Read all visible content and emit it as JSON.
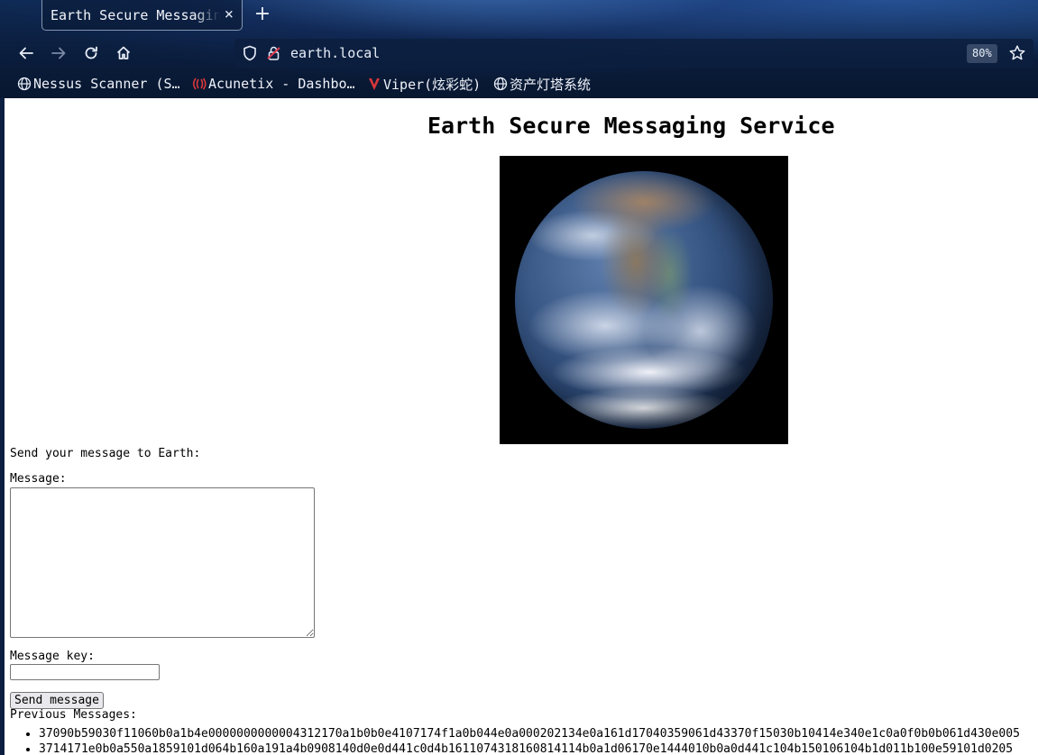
{
  "browser": {
    "tab_title": "Earth Secure Messaging Service",
    "url": "earth.local",
    "zoom": "80%",
    "bookmarks": [
      {
        "label": "Nessus Scanner (S…",
        "icon": "globe-icon"
      },
      {
        "label": "Acunetix - Dashbo…",
        "icon": "acunetix-logo-icon"
      },
      {
        "label": "Viper(炫彩蛇)",
        "icon": "viper-logo-icon"
      },
      {
        "label": "资产灯塔系统",
        "icon": "globe-icon"
      }
    ]
  },
  "page": {
    "title": "Earth Secure Messaging Service",
    "send_heading": "Send your message to Earth:",
    "message_label": "Message:",
    "message_value": "",
    "key_label": "Message key:",
    "key_value": "",
    "send_button": "Send message",
    "previous_label": "Previous Messages:",
    "messages": [
      "37090b59030f11060b0a1b4e0000000000004312170a1b0b0e4107174f1a0b044e0a000202134e0a161d17040359061d43370f15030b10414e340e1c0a0f0b0b061d430e005",
      "3714171e0b0a550a1859101d064b160a191a4b0908140d0e0d441c0d4b1611074318160814114b0a1d06170e1444010b0a0d441c104b150106104b1d011b100e59101d0205"
    ]
  },
  "colors": {
    "chrome_bg": "#0b1f40",
    "accent_lock": "#e0394f",
    "button_bg": "#e9e9ed"
  }
}
